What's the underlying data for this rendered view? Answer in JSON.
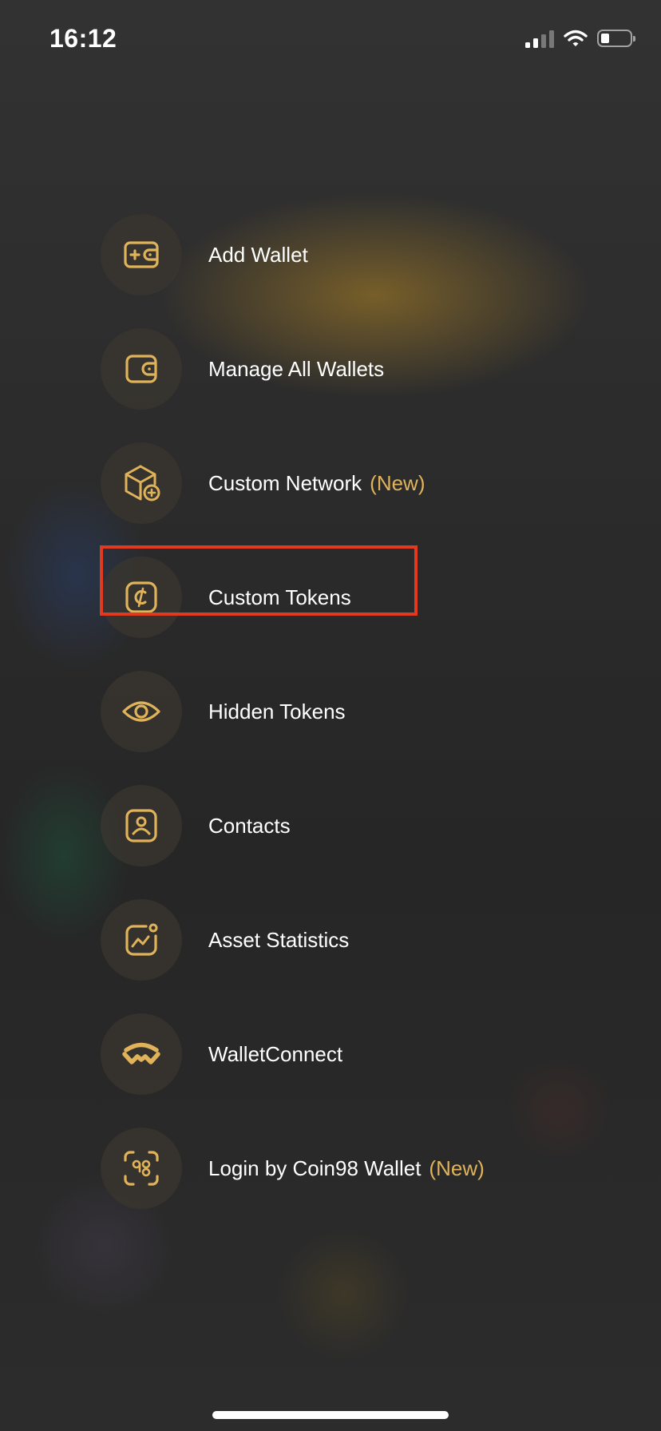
{
  "status_bar": {
    "time": "16:12",
    "icons": [
      "signal-icon",
      "wifi-icon",
      "battery-icon"
    ]
  },
  "menu": {
    "items": [
      {
        "id": "add-wallet",
        "label": "Add Wallet",
        "badge": "",
        "icon": "add-wallet-icon"
      },
      {
        "id": "manage-all-wallets",
        "label": "Manage All Wallets",
        "badge": "",
        "icon": "wallet-icon"
      },
      {
        "id": "custom-network",
        "label": "Custom Network",
        "badge": "(New)",
        "icon": "cube-plus-icon"
      },
      {
        "id": "custom-tokens",
        "label": "Custom Tokens",
        "badge": "",
        "icon": "coin-icon",
        "highlighted": true
      },
      {
        "id": "hidden-tokens",
        "label": "Hidden Tokens",
        "badge": "",
        "icon": "eye-icon"
      },
      {
        "id": "contacts",
        "label": "Contacts",
        "badge": "",
        "icon": "contact-icon"
      },
      {
        "id": "asset-statistics",
        "label": "Asset Statistics",
        "badge": "",
        "icon": "statistics-icon"
      },
      {
        "id": "walletconnect",
        "label": "WalletConnect",
        "badge": "",
        "icon": "walletconnect-icon"
      },
      {
        "id": "login-coin98",
        "label": "Login by Coin98 Wallet",
        "badge": "(New)",
        "icon": "scan-98-icon"
      }
    ]
  },
  "colors": {
    "accent": "#e0b35b",
    "highlight_border": "#e23a1e",
    "icon_circle": "#3a3630"
  }
}
